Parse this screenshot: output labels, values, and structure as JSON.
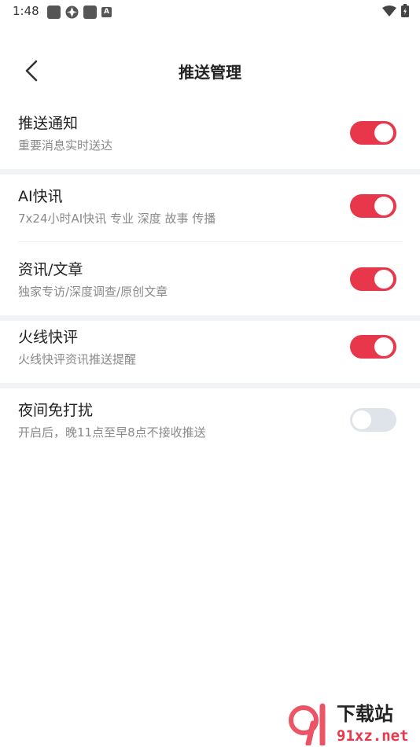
{
  "status_bar": {
    "time": "1:48",
    "badge_letter": "A"
  },
  "header": {
    "title": "推送管理"
  },
  "settings": [
    {
      "title": "推送通知",
      "subtitle": "重要消息实时送达",
      "enabled": true
    },
    {
      "title": "AI快讯",
      "subtitle": "7x24小时AI快讯 专业 深度 故事 传播",
      "enabled": true
    },
    {
      "title": "资讯/文章",
      "subtitle": "独家专访/深度调查/原创文章",
      "enabled": true
    },
    {
      "title": "火线快评",
      "subtitle": "火线快评资讯推送提醒",
      "enabled": true
    },
    {
      "title": "夜间免打扰",
      "subtitle": "开启后，晚11点至早8点不接收推送",
      "enabled": false
    }
  ],
  "watermark": {
    "brand": "下载站",
    "url": "91xz.net"
  },
  "colors": {
    "accent": "#e8374a",
    "toggle_off": "#dfe4ea",
    "section_gap": "#f1f3f6"
  }
}
